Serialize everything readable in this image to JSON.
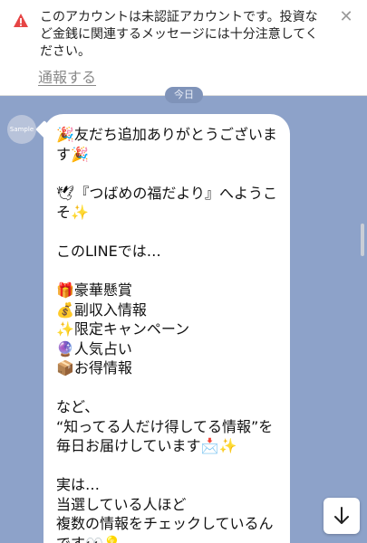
{
  "banner": {
    "warning_text": "このアカウントは未認証アカウントです。投資など金銭に関連するメッセージには十分注意してください。",
    "report_label": "通報する",
    "close_glyph": "✕",
    "warning_color": "#e64545"
  },
  "date_pill": "今日",
  "avatar": {
    "label": "Sample"
  },
  "message": {
    "lines": [
      "🎉友だち追加ありがとうございます🎉",
      "",
      "🕊『つばめの福だより』へようこそ✨",
      "",
      "このLINEでは…",
      "",
      "🎁豪華懸賞",
      "💰副収入情報",
      "✨限定キャンペーン",
      "🔮人気占い",
      "📦お得情報",
      "",
      "など、",
      "“知ってる人だけ得してる情報”を毎日お届けしています📩✨",
      "",
      "実は…",
      "当選している人ほど",
      "複数の情報をチェックしているんです👀💡"
    ]
  },
  "scroll_down_icon": "arrow-down-icon"
}
